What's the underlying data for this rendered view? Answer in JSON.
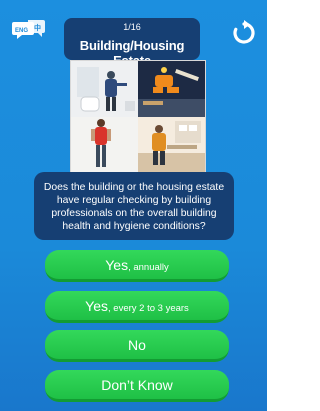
{
  "header": {
    "progress": "1/16",
    "title": "Building/Housing Estate",
    "language_icon": "language-switch-icon",
    "language_label": "ENG",
    "restart_icon": "restart-icon"
  },
  "question": {
    "text": "Does the building or the housing estate have regular checking by building professionals on the overall building health and hygiene conditions?"
  },
  "answers": [
    {
      "main": "Yes",
      "sub": ", annually"
    },
    {
      "main": "Yes",
      "sub": ", every 2 to 3 years"
    },
    {
      "main": "No",
      "sub": ""
    },
    {
      "main": "Don’t Know",
      "sub": ""
    }
  ],
  "colors": {
    "background": "#1b8ad9",
    "panel": "#163f73",
    "answer_button": "#2acb50"
  }
}
